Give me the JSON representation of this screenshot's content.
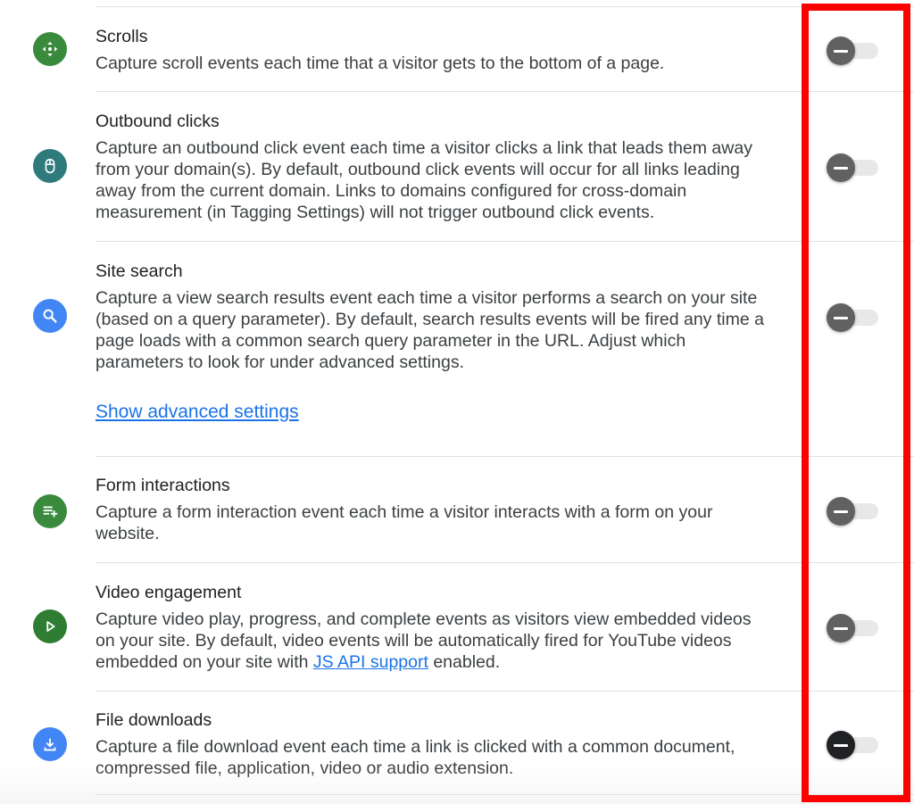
{
  "colors": {
    "highlight_border": "#ff0000",
    "link": "#1a73e8",
    "icon_green": "#2e7d32",
    "icon_teal": "#2f7b7b",
    "icon_blue": "#4285f4"
  },
  "events": [
    {
      "title": "Scrolls",
      "icon": "scroll-icon",
      "icon_color": "#3a8a3e",
      "description": [
        "Capture scroll events each time that a visitor gets to the bottom of a page."
      ],
      "enabled": false
    },
    {
      "title": "Outbound clicks",
      "icon": "mouse-icon",
      "icon_color": "#2f7b7b",
      "description": [
        "Capture an outbound click event each time a visitor clicks a link that leads them away",
        "from your domain(s). By default, outbound click events will occur for all links leading",
        "away from the current domain. Links to domains configured for cross-domain",
        "measurement (in Tagging Settings) will not trigger outbound click events."
      ],
      "enabled": false
    },
    {
      "title": "Site search",
      "icon": "search-icon",
      "icon_color": "#4285f4",
      "description": [
        "Capture a view search results event each time a visitor performs a search on your site",
        "(based on a query parameter). By default, search results events will be fired any time a",
        "page loads with a common search query parameter in the URL. Adjust which",
        "parameters to look for under advanced settings."
      ],
      "advanced_link": "Show advanced settings",
      "enabled": false
    },
    {
      "title": "Form interactions",
      "icon": "form-icon",
      "icon_color": "#3a8a3e",
      "description": [
        "Capture a form interaction event each time a visitor interacts with a form on your",
        "website."
      ],
      "enabled": false
    },
    {
      "title": "Video engagement",
      "icon": "play-icon",
      "icon_color": "#2e7d32",
      "description": [
        "Capture video play, progress, and complete events as visitors view embedded videos",
        "on your site. By default, video events will be automatically fired for YouTube videos"
      ],
      "description_last_prefix": "embedded on your site with ",
      "description_last_link": "JS API support",
      "description_last_suffix": " enabled.",
      "enabled": false
    },
    {
      "title": "File downloads",
      "icon": "download-icon",
      "icon_color": "#4285f4",
      "description": [
        "Capture a file download event each time a link is clicked with a common document,",
        "compressed file, application, video or audio extension."
      ],
      "enabled": false
    }
  ]
}
